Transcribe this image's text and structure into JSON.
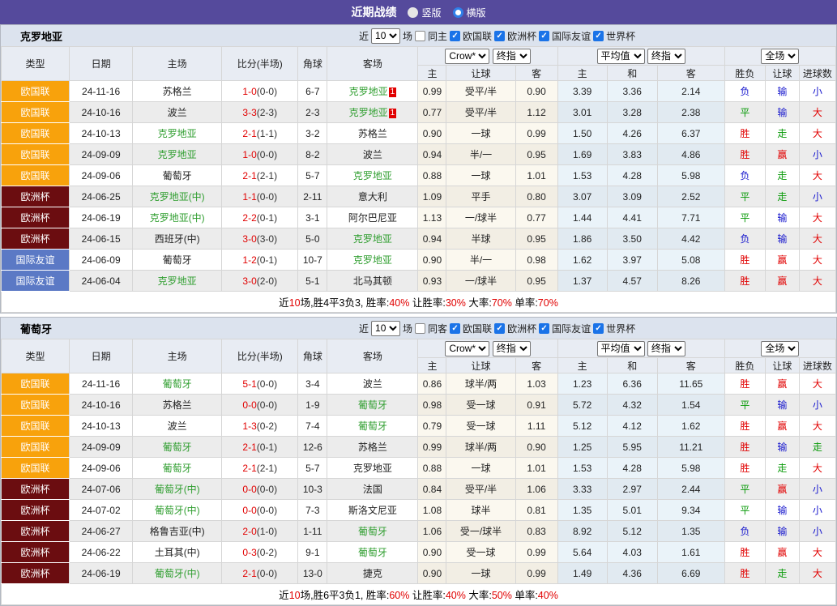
{
  "titlebar": {
    "title": "近期战绩",
    "layout_options": [
      {
        "label": "竖版",
        "selected": false
      },
      {
        "label": "横版",
        "selected": true
      }
    ]
  },
  "filter_bar": {
    "near_label": "近",
    "count": "10",
    "games_label": "场",
    "leagues": [
      "欧国联",
      "欧洲杯",
      "国际友谊",
      "世界杯"
    ]
  },
  "table_header": {
    "left_columns": [
      "类型",
      "日期",
      "主场",
      "比分(半场)",
      "角球",
      "客场"
    ],
    "selects": {
      "odds_source": "Crow*",
      "odds_final": "终指",
      "avg_source": "平均值",
      "avg_final": "终指",
      "scope": "全场"
    },
    "odds_columns": [
      "主",
      "让球",
      "客"
    ],
    "avg_columns": [
      "主",
      "和",
      "客"
    ],
    "result_columns": [
      "胜负",
      "让球",
      "进球数"
    ]
  },
  "colors": {
    "topbar": "#554a9c",
    "league": {
      "欧国联": "#f8a20c",
      "欧洲杯": "#6b0d10",
      "国际友谊": "#5b79c5"
    },
    "red": "#e10000",
    "green": "#089a08",
    "blue": "#1515cd",
    "team_green": "#2f9e2f"
  },
  "sections": [
    {
      "team": "克罗地亚",
      "same_label": "同主",
      "rows": [
        {
          "league": "欧国联",
          "date": "24-11-16",
          "home": "苏格兰",
          "home_hl": false,
          "home_badge": "",
          "score": "1-0",
          "half": "(0-0)",
          "corner": "6-7",
          "away": "克罗地亚",
          "away_hl": true,
          "away_badge": "1",
          "odds": [
            "0.99",
            "受平/半",
            "0.90"
          ],
          "avg": [
            "3.39",
            "3.36",
            "2.14"
          ],
          "res": [
            "负",
            "输",
            "小"
          ],
          "res_c": [
            "b",
            "b",
            "b"
          ]
        },
        {
          "league": "欧国联",
          "date": "24-10-16",
          "home": "波兰",
          "home_hl": false,
          "home_badge": "",
          "score": "3-3",
          "half": "(2-3)",
          "corner": "2-3",
          "away": "克罗地亚",
          "away_hl": true,
          "away_badge": "1",
          "odds": [
            "0.77",
            "受平/半",
            "1.12"
          ],
          "avg": [
            "3.01",
            "3.28",
            "2.38"
          ],
          "res": [
            "平",
            "输",
            "大"
          ],
          "res_c": [
            "g",
            "b",
            "r"
          ]
        },
        {
          "league": "欧国联",
          "date": "24-10-13",
          "home": "克罗地亚",
          "home_hl": true,
          "home_badge": "",
          "score": "2-1",
          "half": "(1-1)",
          "corner": "3-2",
          "away": "苏格兰",
          "away_hl": false,
          "away_badge": "",
          "odds": [
            "0.90",
            "一球",
            "0.99"
          ],
          "avg": [
            "1.50",
            "4.26",
            "6.37"
          ],
          "res": [
            "胜",
            "走",
            "大"
          ],
          "res_c": [
            "r",
            "g",
            "r"
          ]
        },
        {
          "league": "欧国联",
          "date": "24-09-09",
          "home": "克罗地亚",
          "home_hl": true,
          "home_badge": "",
          "score": "1-0",
          "half": "(0-0)",
          "corner": "8-2",
          "away": "波兰",
          "away_hl": false,
          "away_badge": "",
          "odds": [
            "0.94",
            "半/一",
            "0.95"
          ],
          "avg": [
            "1.69",
            "3.83",
            "4.86"
          ],
          "res": [
            "胜",
            "赢",
            "小"
          ],
          "res_c": [
            "r",
            "r",
            "b"
          ]
        },
        {
          "league": "欧国联",
          "date": "24-09-06",
          "home": "葡萄牙",
          "home_hl": false,
          "home_badge": "",
          "score": "2-1",
          "half": "(2-1)",
          "corner": "5-7",
          "away": "克罗地亚",
          "away_hl": true,
          "away_badge": "",
          "odds": [
            "0.88",
            "一球",
            "1.01"
          ],
          "avg": [
            "1.53",
            "4.28",
            "5.98"
          ],
          "res": [
            "负",
            "走",
            "大"
          ],
          "res_c": [
            "b",
            "g",
            "r"
          ]
        },
        {
          "league": "欧洲杯",
          "date": "24-06-25",
          "home": "克罗地亚(中)",
          "home_hl": true,
          "home_badge": "",
          "score": "1-1",
          "half": "(0-0)",
          "corner": "2-11",
          "away": "意大利",
          "away_hl": false,
          "away_badge": "",
          "odds": [
            "1.09",
            "平手",
            "0.80"
          ],
          "avg": [
            "3.07",
            "3.09",
            "2.52"
          ],
          "res": [
            "平",
            "走",
            "小"
          ],
          "res_c": [
            "g",
            "g",
            "b"
          ]
        },
        {
          "league": "欧洲杯",
          "date": "24-06-19",
          "home": "克罗地亚(中)",
          "home_hl": true,
          "home_badge": "",
          "score": "2-2",
          "half": "(0-1)",
          "corner": "3-1",
          "away": "阿尔巴尼亚",
          "away_hl": false,
          "away_badge": "",
          "odds": [
            "1.13",
            "一/球半",
            "0.77"
          ],
          "avg": [
            "1.44",
            "4.41",
            "7.71"
          ],
          "res": [
            "平",
            "输",
            "大"
          ],
          "res_c": [
            "g",
            "b",
            "r"
          ]
        },
        {
          "league": "欧洲杯",
          "date": "24-06-15",
          "home": "西班牙(中)",
          "home_hl": false,
          "home_badge": "",
          "score": "3-0",
          "half": "(3-0)",
          "corner": "5-0",
          "away": "克罗地亚",
          "away_hl": true,
          "away_badge": "",
          "odds": [
            "0.94",
            "半球",
            "0.95"
          ],
          "avg": [
            "1.86",
            "3.50",
            "4.42"
          ],
          "res": [
            "负",
            "输",
            "大"
          ],
          "res_c": [
            "b",
            "b",
            "r"
          ]
        },
        {
          "league": "国际友谊",
          "date": "24-06-09",
          "home": "葡萄牙",
          "home_hl": false,
          "home_badge": "",
          "score": "1-2",
          "half": "(0-1)",
          "corner": "10-7",
          "away": "克罗地亚",
          "away_hl": true,
          "away_badge": "",
          "odds": [
            "0.90",
            "半/一",
            "0.98"
          ],
          "avg": [
            "1.62",
            "3.97",
            "5.08"
          ],
          "res": [
            "胜",
            "赢",
            "大"
          ],
          "res_c": [
            "r",
            "r",
            "r"
          ]
        },
        {
          "league": "国际友谊",
          "date": "24-06-04",
          "home": "克罗地亚",
          "home_hl": true,
          "home_badge": "",
          "score": "3-0",
          "half": "(2-0)",
          "corner": "5-1",
          "away": "北马其顿",
          "away_hl": false,
          "away_badge": "",
          "odds": [
            "0.93",
            "一/球半",
            "0.95"
          ],
          "avg": [
            "1.37",
            "4.57",
            "8.26"
          ],
          "res": [
            "胜",
            "赢",
            "大"
          ],
          "res_c": [
            "r",
            "r",
            "r"
          ]
        }
      ],
      "summary": [
        [
          "近",
          0
        ],
        [
          "10",
          1
        ],
        [
          "场,胜4平3负3, 胜率:",
          0
        ],
        [
          "40%",
          1
        ],
        [
          " 让胜率:",
          0
        ],
        [
          "30%",
          1
        ],
        [
          " 大率:",
          0
        ],
        [
          "70%",
          1
        ],
        [
          " 单率:",
          0
        ],
        [
          "70%",
          1
        ]
      ]
    },
    {
      "team": "葡萄牙",
      "same_label": "同客",
      "rows": [
        {
          "league": "欧国联",
          "date": "24-11-16",
          "home": "葡萄牙",
          "home_hl": true,
          "home_badge": "",
          "score": "5-1",
          "half": "(0-0)",
          "corner": "3-4",
          "away": "波兰",
          "away_hl": false,
          "away_badge": "",
          "odds": [
            "0.86",
            "球半/两",
            "1.03"
          ],
          "avg": [
            "1.23",
            "6.36",
            "11.65"
          ],
          "res": [
            "胜",
            "赢",
            "大"
          ],
          "res_c": [
            "r",
            "r",
            "r"
          ]
        },
        {
          "league": "欧国联",
          "date": "24-10-16",
          "home": "苏格兰",
          "home_hl": false,
          "home_badge": "",
          "score": "0-0",
          "half": "(0-0)",
          "corner": "1-9",
          "away": "葡萄牙",
          "away_hl": true,
          "away_badge": "",
          "odds": [
            "0.98",
            "受一球",
            "0.91"
          ],
          "avg": [
            "5.72",
            "4.32",
            "1.54"
          ],
          "res": [
            "平",
            "输",
            "小"
          ],
          "res_c": [
            "g",
            "b",
            "b"
          ]
        },
        {
          "league": "欧国联",
          "date": "24-10-13",
          "home": "波兰",
          "home_hl": false,
          "home_badge": "",
          "score": "1-3",
          "half": "(0-2)",
          "corner": "7-4",
          "away": "葡萄牙",
          "away_hl": true,
          "away_badge": "",
          "odds": [
            "0.79",
            "受一球",
            "1.11"
          ],
          "avg": [
            "5.12",
            "4.12",
            "1.62"
          ],
          "res": [
            "胜",
            "赢",
            "大"
          ],
          "res_c": [
            "r",
            "r",
            "r"
          ]
        },
        {
          "league": "欧国联",
          "date": "24-09-09",
          "home": "葡萄牙",
          "home_hl": true,
          "home_badge": "",
          "score": "2-1",
          "half": "(0-1)",
          "corner": "12-6",
          "away": "苏格兰",
          "away_hl": false,
          "away_badge": "",
          "odds": [
            "0.99",
            "球半/两",
            "0.90"
          ],
          "avg": [
            "1.25",
            "5.95",
            "11.21"
          ],
          "res": [
            "胜",
            "输",
            "走"
          ],
          "res_c": [
            "r",
            "b",
            "g"
          ]
        },
        {
          "league": "欧国联",
          "date": "24-09-06",
          "home": "葡萄牙",
          "home_hl": true,
          "home_badge": "",
          "score": "2-1",
          "half": "(2-1)",
          "corner": "5-7",
          "away": "克罗地亚",
          "away_hl": false,
          "away_badge": "",
          "odds": [
            "0.88",
            "一球",
            "1.01"
          ],
          "avg": [
            "1.53",
            "4.28",
            "5.98"
          ],
          "res": [
            "胜",
            "走",
            "大"
          ],
          "res_c": [
            "r",
            "g",
            "r"
          ]
        },
        {
          "league": "欧洲杯",
          "date": "24-07-06",
          "home": "葡萄牙(中)",
          "home_hl": true,
          "home_badge": "",
          "score": "0-0",
          "half": "(0-0)",
          "corner": "10-3",
          "away": "法国",
          "away_hl": false,
          "away_badge": "",
          "odds": [
            "0.84",
            "受平/半",
            "1.06"
          ],
          "avg": [
            "3.33",
            "2.97",
            "2.44"
          ],
          "res": [
            "平",
            "赢",
            "小"
          ],
          "res_c": [
            "g",
            "r",
            "b"
          ]
        },
        {
          "league": "欧洲杯",
          "date": "24-07-02",
          "home": "葡萄牙(中)",
          "home_hl": true,
          "home_badge": "",
          "score": "0-0",
          "half": "(0-0)",
          "corner": "7-3",
          "away": "斯洛文尼亚",
          "away_hl": false,
          "away_badge": "",
          "odds": [
            "1.08",
            "球半",
            "0.81"
          ],
          "avg": [
            "1.35",
            "5.01",
            "9.34"
          ],
          "res": [
            "平",
            "输",
            "小"
          ],
          "res_c": [
            "g",
            "b",
            "b"
          ]
        },
        {
          "league": "欧洲杯",
          "date": "24-06-27",
          "home": "格鲁吉亚(中)",
          "home_hl": false,
          "home_badge": "",
          "score": "2-0",
          "half": "(1-0)",
          "corner": "1-11",
          "away": "葡萄牙",
          "away_hl": true,
          "away_badge": "",
          "odds": [
            "1.06",
            "受一/球半",
            "0.83"
          ],
          "avg": [
            "8.92",
            "5.12",
            "1.35"
          ],
          "res": [
            "负",
            "输",
            "小"
          ],
          "res_c": [
            "b",
            "b",
            "b"
          ]
        },
        {
          "league": "欧洲杯",
          "date": "24-06-22",
          "home": "土耳其(中)",
          "home_hl": false,
          "home_badge": "",
          "score": "0-3",
          "half": "(0-2)",
          "corner": "9-1",
          "away": "葡萄牙",
          "away_hl": true,
          "away_badge": "",
          "odds": [
            "0.90",
            "受一球",
            "0.99"
          ],
          "avg": [
            "5.64",
            "4.03",
            "1.61"
          ],
          "res": [
            "胜",
            "赢",
            "大"
          ],
          "res_c": [
            "r",
            "r",
            "r"
          ]
        },
        {
          "league": "欧洲杯",
          "date": "24-06-19",
          "home": "葡萄牙(中)",
          "home_hl": true,
          "home_badge": "",
          "score": "2-1",
          "half": "(0-0)",
          "corner": "13-0",
          "away": "捷克",
          "away_hl": false,
          "away_badge": "",
          "odds": [
            "0.90",
            "一球",
            "0.99"
          ],
          "avg": [
            "1.49",
            "4.36",
            "6.69"
          ],
          "res": [
            "胜",
            "走",
            "大"
          ],
          "res_c": [
            "r",
            "g",
            "r"
          ]
        }
      ],
      "summary": [
        [
          "近",
          0
        ],
        [
          "10",
          1
        ],
        [
          "场,胜6平3负1, 胜率:",
          0
        ],
        [
          "60%",
          1
        ],
        [
          " 让胜率:",
          0
        ],
        [
          "40%",
          1
        ],
        [
          " 大率:",
          0
        ],
        [
          "50%",
          1
        ],
        [
          " 单率:",
          0
        ],
        [
          "40%",
          1
        ]
      ]
    }
  ]
}
